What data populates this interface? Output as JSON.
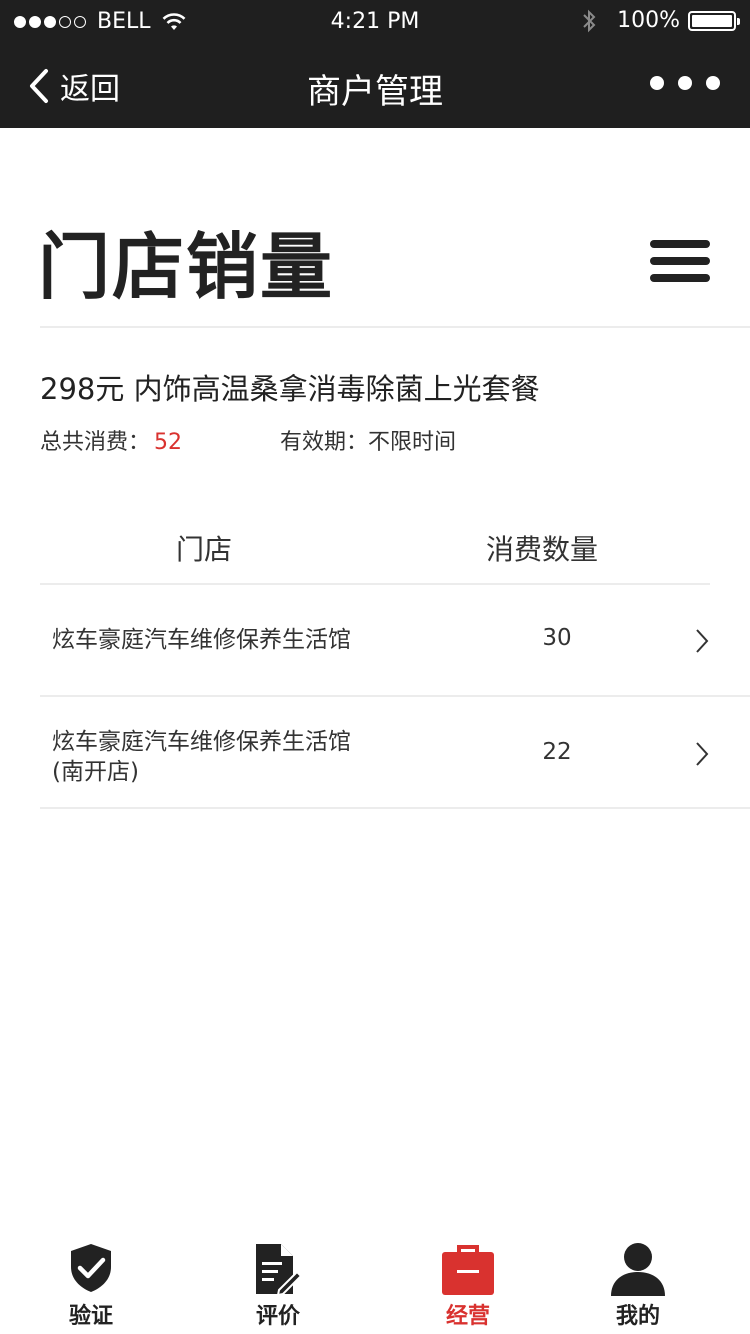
{
  "status_bar": {
    "carrier": "BELL",
    "time": "4:21 PM",
    "battery": "100%"
  },
  "nav": {
    "back_label": "返回",
    "title": "商户管理"
  },
  "page": {
    "title": "门店销量"
  },
  "package": {
    "title": "298元 内饰高温桑拿消毒除菌上光套餐",
    "total_label": "总共消费：",
    "total_value": "52",
    "validity_label": "有效期：",
    "validity_value": "不限时间"
  },
  "table": {
    "headers": {
      "store": "门店",
      "quantity": "消费数量"
    },
    "rows": [
      {
        "name": "炫车豪庭汽车维修保养生活馆",
        "count": "30"
      },
      {
        "name": "炫车豪庭汽车维修保养生活馆(南开店)",
        "count": "22"
      }
    ]
  },
  "tab_bar": {
    "items": [
      {
        "label": "验证",
        "icon": "shield-check-icon"
      },
      {
        "label": "评价",
        "icon": "document-edit-icon"
      },
      {
        "label": "经营",
        "icon": "briefcase-icon",
        "active": true
      },
      {
        "label": "我的",
        "icon": "user-icon"
      }
    ]
  },
  "colors": {
    "bar_background": "#1f1f1f",
    "accent_red": "#d9322f",
    "text_dark": "#222222"
  }
}
